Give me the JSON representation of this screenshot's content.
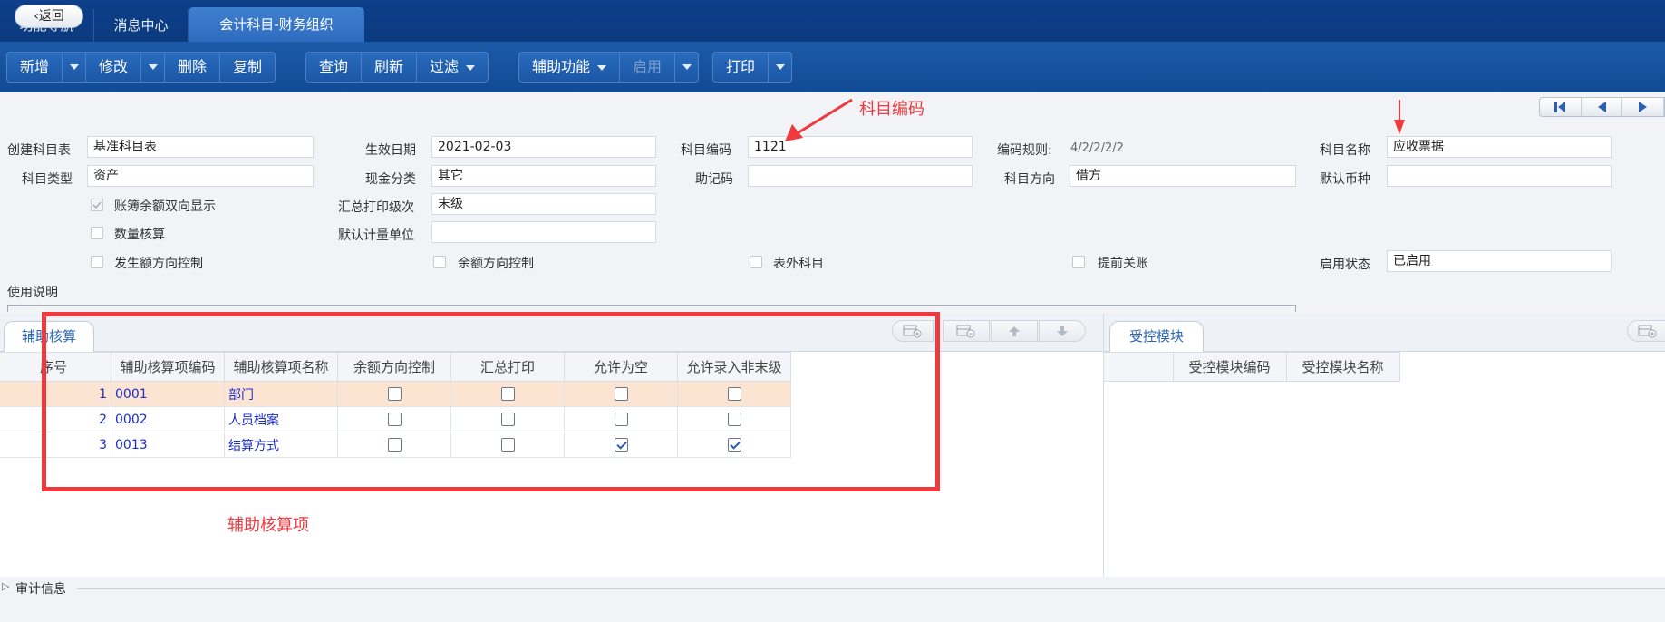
{
  "tabs": [
    {
      "label": "功能导航"
    },
    {
      "label": "消息中心"
    },
    {
      "label": "会计科目-财务组织"
    }
  ],
  "toolbar": {
    "new": "新增",
    "edit": "修改",
    "delete": "删除",
    "copy": "复制",
    "query": "查询",
    "refresh": "刷新",
    "filter": "过滤",
    "aux_func": "辅助功能",
    "enable": "启用",
    "print": "打印"
  },
  "back": "返回",
  "form": {
    "create_table_label": "创建科目表",
    "create_table_value": "基准科目表",
    "effective_date_label": "生效日期",
    "effective_date_value": "2021-02-03",
    "subject_code_label": "科目编码",
    "subject_code_value": "1121",
    "code_rule_label": "编码规则:",
    "code_rule_value": "4/2/2/2/2",
    "subject_name_label": "科目名称",
    "subject_name_value": "应收票据",
    "subject_type_label": "科目类型",
    "subject_type_value": "资产",
    "cash_class_label": "现金分类",
    "cash_class_value": "其它",
    "mnemonic_label": "助记码",
    "mnemonic_value": "",
    "direction_label": "科目方向",
    "direction_value": "借方",
    "default_currency_label": "默认币种",
    "default_currency_value": "",
    "ledger_bidir_label": "账簿余额双向显示",
    "summary_level_label": "汇总打印级次",
    "summary_level_value": "末级",
    "qty_label": "数量核算",
    "default_unit_label": "默认计量单位",
    "default_unit_value": "",
    "occur_dir_label": "发生额方向控制",
    "balance_dir_label": "余额方向控制",
    "offbook_label": "表外科目",
    "early_close_label": "提前关账",
    "status_label": "启用状态",
    "status_value": "已启用",
    "usage_label": "使用说明"
  },
  "aux_panel": {
    "tab": "辅助核算",
    "columns": [
      "序号",
      "辅助核算项编码",
      "辅助核算项名称",
      "余额方向控制",
      "汇总打印",
      "允许为空",
      "允许录入非末级"
    ],
    "rows": [
      {
        "no": "1",
        "code": "0001",
        "name": "部门",
        "balance_ctrl": false,
        "summary_print": false,
        "allow_empty": false,
        "allow_nonleaf": false
      },
      {
        "no": "2",
        "code": "0002",
        "name": "人员档案",
        "balance_ctrl": false,
        "summary_print": false,
        "allow_empty": false,
        "allow_nonleaf": false
      },
      {
        "no": "3",
        "code": "0013",
        "name": "结算方式",
        "balance_ctrl": false,
        "summary_print": false,
        "allow_empty": true,
        "allow_nonleaf": true
      }
    ]
  },
  "module_panel": {
    "tab": "受控模块",
    "columns": [
      "受控模块编码",
      "受控模块名称"
    ]
  },
  "audit": "审计信息",
  "annotations": {
    "code": "科目编码",
    "aux": "辅助核算项"
  },
  "colors": {
    "annotation": "#ee3a3f",
    "topbar": "#0d3f8a",
    "link": "#1c2fc7"
  }
}
